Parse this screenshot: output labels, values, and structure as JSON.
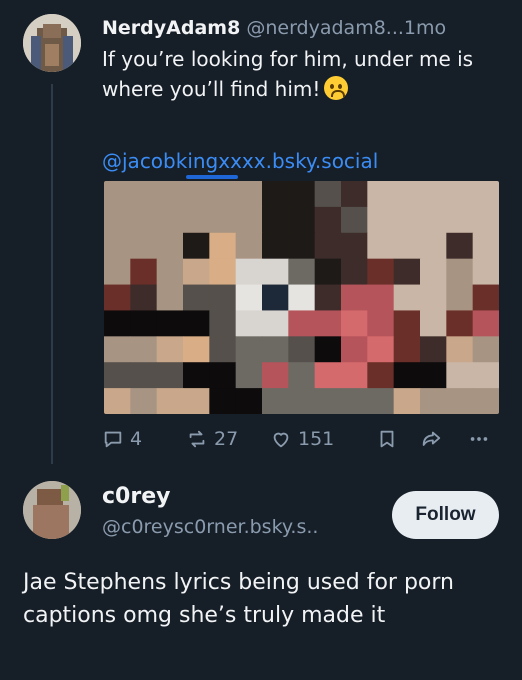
{
  "post1": {
    "author": "NerdyAdam8",
    "handle": "@nerdyadam8...",
    "time": "1mo",
    "text": "If you’re looking for him, under me is where you’ll find him!",
    "mention": "@jacobkingxxxx.bsky.social",
    "actions": {
      "reply_count": "4",
      "repost_count": "27",
      "like_count": "151"
    },
    "icons": [
      "reply-icon",
      "repost-icon",
      "like-icon",
      "bookmark-icon",
      "share-icon",
      "more-icon"
    ]
  },
  "post2": {
    "author": "c0rey",
    "handle": "@c0reysc0rner.bsky.s..",
    "follow_label": "Follow",
    "text": "Jae Stephens lyrics being used for porn captions omg she’s truly made it"
  },
  "colors": {
    "background": "#161e27",
    "muted": "#8a9bae",
    "link": "#3b8df5",
    "follow_button": "#e8edf2"
  }
}
